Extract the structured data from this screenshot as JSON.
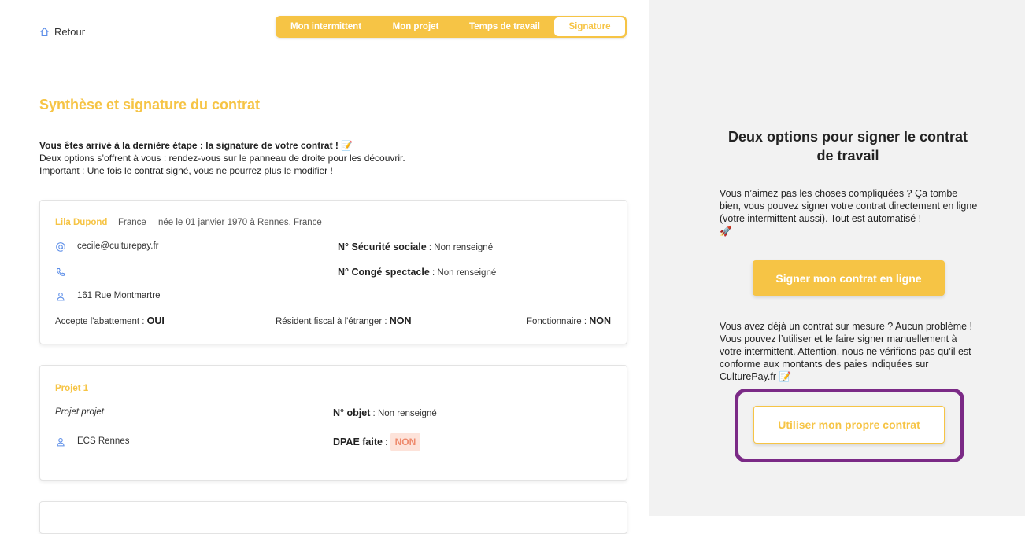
{
  "nav": {
    "back_label": "Retour"
  },
  "steps": [
    {
      "label": "Mon intermittent",
      "active": false
    },
    {
      "label": "Mon projet",
      "active": false
    },
    {
      "label": "Temps de travail",
      "active": false
    },
    {
      "label": "Signature",
      "active": true
    }
  ],
  "page": {
    "title": "Synthèse et signature du contrat",
    "intro_bold": "Vous êtes arrivé à la dernière étape : la signature de votre contrat !",
    "intro_emoji": "📝",
    "intro_line2": "Deux options s’offrent à vous : rendez-vous sur le panneau de droite pour les découvrir.",
    "intro_line3": "Important : Une fois le contrat signé, vous ne pourrez plus le modifier !"
  },
  "person": {
    "name": "Lila Dupond",
    "country": "France",
    "birth": "née le 01 janvier 1970 à Rennes, France",
    "email": "cecile@culturepay.fr",
    "phone": "",
    "address": "161 Rue Montmartre",
    "secu_label": "N° Sécurité sociale",
    "secu_value": " : Non renseigné",
    "conge_label": "N° Congé spectacle",
    "conge_value": " : Non renseigné",
    "abattement_label": "Accepte l'abattement : ",
    "abattement_value": "OUI",
    "resident_label": "Résident fiscal à l'étranger : ",
    "resident_value": "NON",
    "fonctionnaire_label": "Fonctionnaire : ",
    "fonctionnaire_value": "NON"
  },
  "project": {
    "heading": "Projet 1",
    "name": "Projet projet",
    "objet_label": "N° objet",
    "objet_value": " : Non renseigné",
    "place": "ECS Rennes",
    "dpae_label": "DPAE faite",
    "dpae_sep": " : ",
    "dpae_value": "NON"
  },
  "right_panel": {
    "title": "Deux options pour signer le contrat de travail",
    "text1": "Vous n’aimez pas les choses compliquées ? Ça tombe bien, vous pouvez signer votre contrat directement en ligne (votre intermittent aussi). Tout est automatisé !",
    "text1_emoji": "🚀",
    "sign_online_label": "Signer mon contrat en ligne",
    "text2": "Vous avez déjà un contrat sur mesure ? Aucun problème ! Vous pouvez l’utiliser et le faire signer manuellement à votre intermittent. Attention, nous ne vérifions pas qu’il est conforme aux montants des paies indiquées sur CulturePay.fr",
    "text2_emoji": "📝",
    "own_contract_label": "Utiliser mon propre contrat"
  },
  "colors": {
    "accent": "#f6c445",
    "highlight": "#7b2a86",
    "badge_bg": "#fde3da",
    "badge_text": "#ee8a6d",
    "panel_bg": "#f2f2f2",
    "icon_blue": "#5b8de8"
  }
}
